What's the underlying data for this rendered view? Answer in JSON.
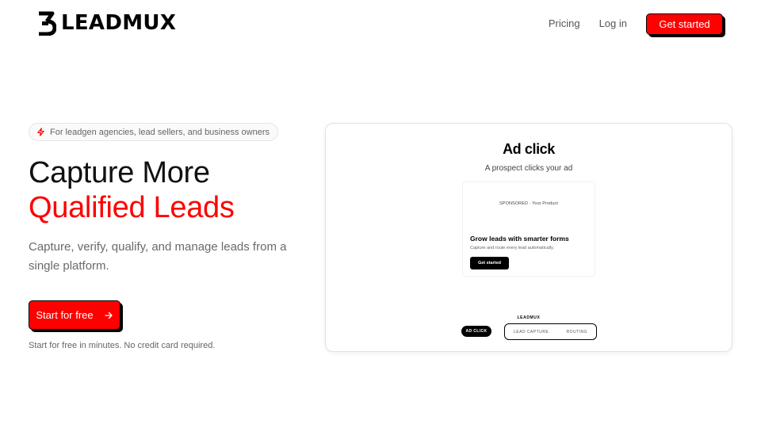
{
  "brand": {
    "name": "LEADMUX"
  },
  "nav": {
    "pricing": "Pricing",
    "login": "Log in",
    "cta": "Get started"
  },
  "hero": {
    "pill": "For leadgen agencies, lead sellers, and business owners",
    "headline_line1": "Capture More",
    "headline_line2": "Qualified Leads",
    "subtext": "Capture, verify, qualify, and manage leads from a single platform.",
    "cta": "Start for free",
    "note": "Start for free in minutes. No credit card required."
  },
  "demo": {
    "title": "Ad click",
    "subtitle": "A prospect clicks your ad",
    "ad": {
      "sponsored": "SPONSORED · Your Product",
      "headline": "Grow leads with smarter forms",
      "description": "Capture and route every lead automatically.",
      "button": "Get started"
    },
    "brand": "LEADMUX",
    "steps": {
      "active": "AD CLICK",
      "next": "LEAD CAPTURE",
      "last": "ROUTING"
    }
  },
  "colors": {
    "accent": "#ff0000",
    "text": "#111111",
    "muted": "#6a6a6a"
  },
  "icons": {
    "logo": "leadmux-logo-icon",
    "pill": "lightning-icon",
    "cta": "arrow-right-icon"
  }
}
